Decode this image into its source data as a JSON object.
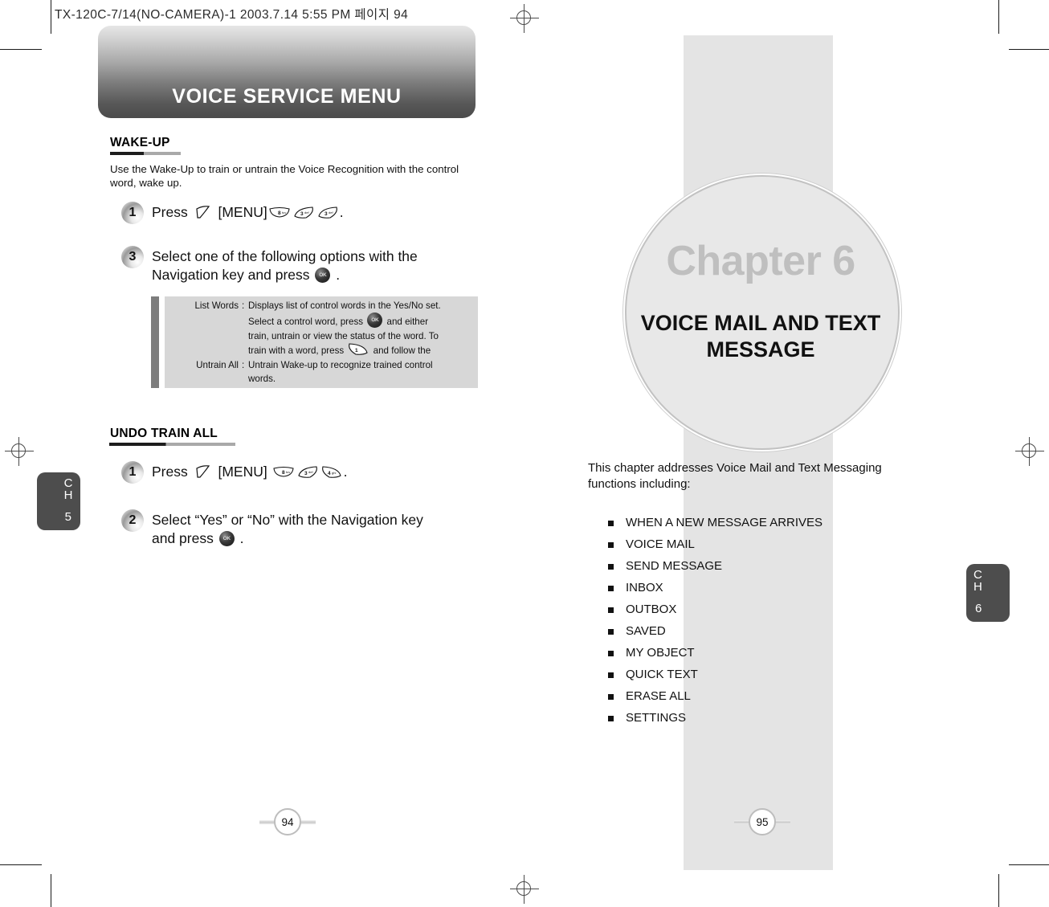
{
  "scan": {
    "header_line": "TX-120C-7/14(NO-CAMERA)-1  2003.7.14 5:55 PM 페이지 94"
  },
  "left_page": {
    "title_bar": "VOICE SERVICE MENU",
    "page_number": "94",
    "chapter_tab": {
      "ch_c": "C",
      "ch_h": "H",
      "number": "5"
    },
    "sections": [
      {
        "heading": "WAKE-UP",
        "intro": "Use the Wake-Up to train or untrain the Voice Recognition with the control word, wake up.",
        "steps": [
          {
            "number": "1",
            "text_before": "Press",
            "menu_label": "[MENU]",
            "keys": [
              "8",
              "3",
              "3"
            ],
            "text_after": "."
          },
          {
            "number": "3",
            "line1": "Select one of the following options with the",
            "line2_before": "Navigation key and press",
            "line2_after": "."
          }
        ],
        "infobox": {
          "rows": [
            {
              "label": "List Words",
              "lines": [
                "Displays list of control words in the Yes/No set.",
                "Select a control word, press  [OK]  and either",
                "train, untrain or view the status of the word. To",
                "train with a word, press  [key]  and follow the"
              ]
            },
            {
              "label": "Untrain All",
              "lines": [
                "Untrain Wake-up to recognize trained control",
                "words."
              ]
            }
          ]
        }
      },
      {
        "heading": "UNDO TRAIN ALL",
        "steps": [
          {
            "number": "1",
            "text_before": "Press",
            "menu_label": "[MENU]",
            "keys": [
              "8",
              "3",
              "4"
            ],
            "text_after": "."
          },
          {
            "number": "2",
            "line1": "Select “Yes” or “No” with the Navigation key",
            "line2_before": "and press",
            "line2_after": "."
          }
        ]
      }
    ]
  },
  "right_page": {
    "page_number": "95",
    "chapter_tab": {
      "ch_c": "C",
      "ch_h": "H",
      "number": "6"
    },
    "chapter_badge": {
      "watermark": "Chapter 6",
      "title_line1": "VOICE MAIL AND TEXT",
      "title_line2": "MESSAGE"
    },
    "intro": "This chapter addresses Voice Mail and Text Messaging functions including:",
    "topics": [
      "WHEN A NEW MESSAGE ARRIVES",
      "VOICE MAIL",
      "SEND MESSAGE",
      "INBOX",
      "OUTBOX",
      "SAVED",
      "MY OBJECT",
      "QUICK TEXT",
      "ERASE ALL",
      "SETTINGS"
    ]
  },
  "colors": {
    "title_bar_dark": "#4b4b4b",
    "tab_gray": "#4d4d4d",
    "infobox_gray": "#d7d7d7",
    "band_gray": "#e4e4e4",
    "watermark_gray": "#bfbfbf"
  }
}
